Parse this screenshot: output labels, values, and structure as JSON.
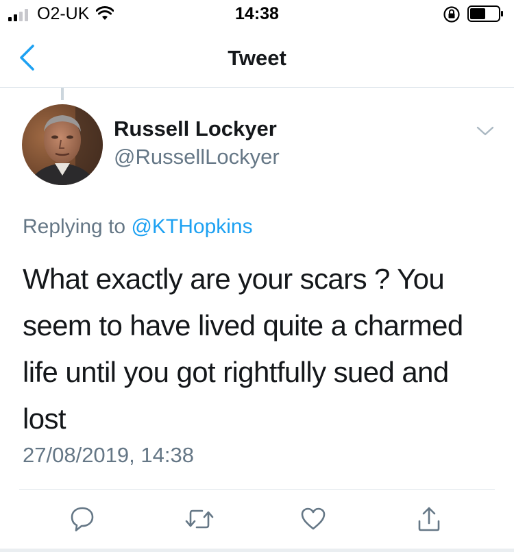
{
  "status_bar": {
    "carrier": "O2-UK",
    "time": "14:38"
  },
  "nav": {
    "title": "Tweet",
    "back_icon": "chevron-left-icon"
  },
  "tweet": {
    "display_name": "Russell Lockyer",
    "handle": "@RussellLockyer",
    "replying_prefix": "Replying to",
    "replying_to": "@KTHopkins",
    "text": "What exactly are your scars ? You seem to have lived quite a charmed life until you got rightfully sued and lost",
    "timestamp": "27/08/2019, 14:38"
  },
  "actions": {
    "icons": [
      "reply-icon",
      "retweet-icon",
      "like-icon",
      "share-icon"
    ]
  },
  "colors": {
    "accent": "#1da1f2",
    "secondary_text": "#657786",
    "divider": "#e1e8ed"
  }
}
